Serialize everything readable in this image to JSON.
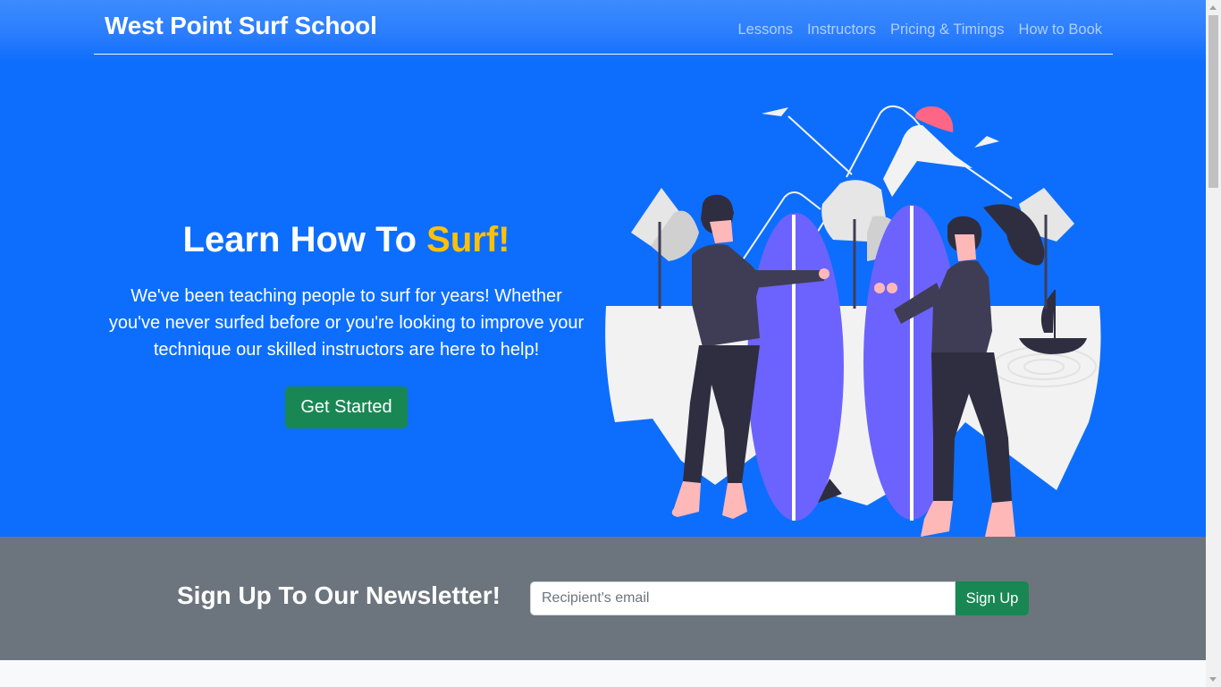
{
  "navbar": {
    "brand": "West Point Surf School",
    "links": [
      "Lessons",
      "Instructors",
      "Pricing & Timings",
      "How to Book"
    ]
  },
  "hero": {
    "title_main": "Learn How To ",
    "title_accent": "Surf!",
    "description": "We've been teaching people to surf for years! Whether you've never surfed before or you're looking to improve your technique our skilled instructors are here to help!",
    "cta_label": "Get Started"
  },
  "newsletter": {
    "title": "Sign Up To Our Newsletter!",
    "email_placeholder": "Recipient's email",
    "button_label": "Sign Up"
  },
  "colors": {
    "primary": "#0d6efd",
    "accent": "#ffc107",
    "success": "#198754",
    "secondary": "#6c757d",
    "light": "#f8f9fa"
  },
  "icons": {
    "illustration": "surfers-with-boards-illustration"
  }
}
